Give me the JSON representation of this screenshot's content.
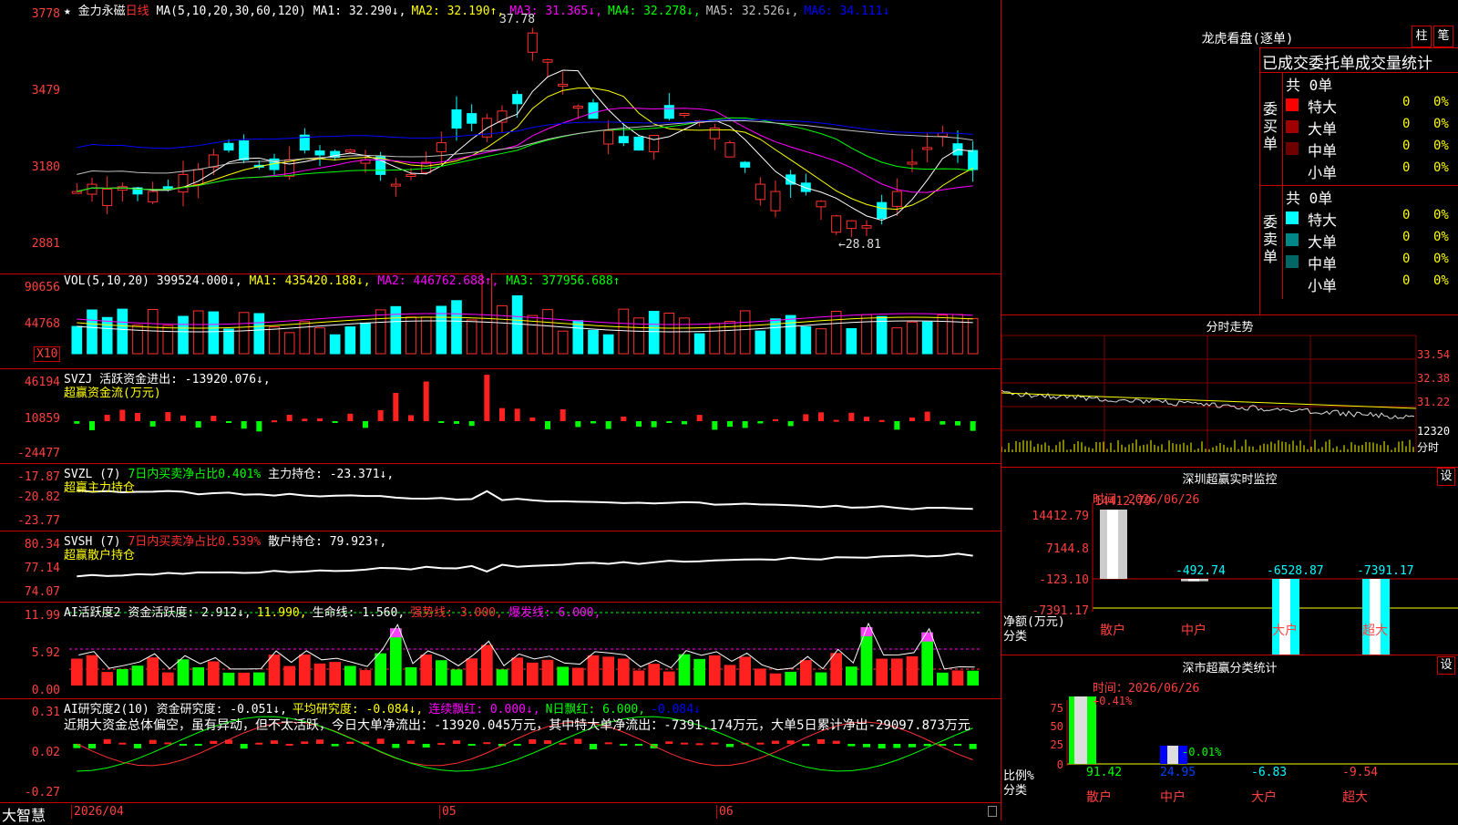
{
  "stock": {
    "name": "金力永磁",
    "period": "日线",
    "star": "★"
  },
  "main": {
    "ma_header": "MA(5,10,20,30,60,120)",
    "ma": [
      {
        "label": "MA1: 32.290↓,",
        "color": "#ffffff"
      },
      {
        "label": "MA2: 32.190↑,",
        "color": "#ffff00"
      },
      {
        "label": "MA3: 31.365↓,",
        "color": "#ff00ff"
      },
      {
        "label": "MA4: 32.278↓,",
        "color": "#00ff00"
      },
      {
        "label": "MA5: 32.526↓,",
        "color": "#c0c0c0"
      },
      {
        "label": "MA6: 34.111↓",
        "color": "#0000ff"
      }
    ],
    "high_label": "37.78",
    "low_label": "←28.81",
    "axis": [
      "3778",
      "3479",
      "3180",
      "2881"
    ],
    "price_range": [
      28.81,
      37.78
    ]
  },
  "vol": {
    "header": "VOL(5,10,20)",
    "value": "399524.000↓,",
    "ma1": "MA1: 435420.188↓,",
    "ma2": "MA2: 446762.688↑,",
    "ma3": "MA3: 377956.688↑",
    "axis": [
      "90656",
      "44768"
    ],
    "unit": "X10"
  },
  "svzj": {
    "header": "SVZJ",
    "desc": "活跃资金进出: -13920.076↓,",
    "sub": "超赢资金流(万元)",
    "axis": [
      "46194",
      "10859",
      "-24477"
    ]
  },
  "svzl": {
    "header": "SVZL (7)",
    "desc1": "7日内买卖净占比0.401%",
    "desc2": "主力持仓: -23.371↓,",
    "sub": "超赢主力持仓",
    "axis": [
      "-17.87",
      "-20.82",
      "-23.77"
    ]
  },
  "svsh": {
    "header": "SVSH (7)",
    "desc1": "7日内买卖净占比0.539%",
    "desc2": "散户持仓: 79.923↑,",
    "sub": "超赢散户持仓",
    "axis": [
      "80.34",
      "77.14",
      "74.07"
    ]
  },
  "ai1": {
    "header": "AI活跃度2",
    "parts": [
      {
        "text": "资金活跃度: 2.912↓,",
        "color": "#ffffff"
      },
      {
        "text": "11.990,",
        "color": "#ffff00"
      },
      {
        "text": "生命线: 1.560,",
        "color": "#ffffff"
      },
      {
        "text": "强势线: 3.000,",
        "color": "#ff3030"
      },
      {
        "text": "爆发线: 6.000,",
        "color": "#ff00ff"
      }
    ],
    "axis": [
      "11.99",
      "5.92",
      "0.00"
    ]
  },
  "ai2": {
    "header": "AI研究度2(10)",
    "parts": [
      {
        "text": "资金研究度: -0.051↓,",
        "color": "#ffffff"
      },
      {
        "text": "平均研究度: -0.084↓,",
        "color": "#ffff00"
      },
      {
        "text": "连续飘红: 0.000↓,",
        "color": "#ff00ff"
      },
      {
        "text": "N日飘红: 6.000,",
        "color": "#00ff00"
      },
      {
        "text": "-0.084↓",
        "color": "#0000ff"
      }
    ],
    "summary": "近期大资金总体偏空，虽有异动，但不太活跃，今日大单净流出：-13920.045万元，其中特大单净流出：-7391.174万元，大单5日累计净出-29097.873万元",
    "axis": [
      "0.31",
      "0.02",
      "-0.27"
    ]
  },
  "bottom": {
    "brand": "大智慧",
    "date": "2026/04",
    "m05": "05",
    "m06": "06"
  },
  "longhu": {
    "title": "龙虎看盘(逐单)",
    "btn1": "柱",
    "btn2": "笔",
    "tab_header": "已成交委托单成交量统计",
    "buy": {
      "total": "共 0单",
      "side": "委买单",
      "rows": [
        {
          "name": "特大",
          "val": "0",
          "pct": "0%",
          "color": "#ff0000"
        },
        {
          "name": "大单",
          "val": "0",
          "pct": "0%",
          "color": "#a00000"
        },
        {
          "name": "中单",
          "val": "0",
          "pct": "0%",
          "color": "#700000"
        },
        {
          "name": "小单",
          "val": "0",
          "pct": "0%",
          "color": "#000000"
        }
      ]
    },
    "sell": {
      "total": "共 0单",
      "side": "委卖单",
      "rows": [
        {
          "name": "特大",
          "val": "0",
          "pct": "0%",
          "color": "#00ffff"
        },
        {
          "name": "大单",
          "val": "0",
          "pct": "0%",
          "color": "#008888"
        },
        {
          "name": "中单",
          "val": "0",
          "pct": "0%",
          "color": "#006666"
        },
        {
          "name": "小单",
          "val": "0",
          "pct": "0%",
          "color": "#000000"
        }
      ]
    }
  },
  "fenshi": {
    "title": "分时走势",
    "axis": [
      "33.54",
      "32.38",
      "31.22"
    ],
    "vol": "12320",
    "unit": "分时"
  },
  "monitor": {
    "title": "深圳超赢实时监控",
    "btn": "设",
    "time": "时间：2026/06/26",
    "axis": [
      "14412.79",
      "7144.8",
      "-123.10",
      "-7391.17"
    ],
    "values": [
      {
        "label": "14412.79",
        "num": 14412.79
      },
      {
        "label": "-492.74",
        "num": -492.74
      },
      {
        "label": "-6528.87",
        "num": -6528.87
      },
      {
        "label": "-7391.17",
        "num": -7391.17
      }
    ],
    "ylabel": "净额(万元)",
    "xlabel": "分类",
    "cats": [
      "散户",
      "中户",
      "大户",
      "超大"
    ]
  },
  "stats": {
    "title": "深市超赢分类统计",
    "btn": "设",
    "time": "时间：2026/06/26",
    "top_labels": [
      "+0.41%",
      "-0.01%"
    ],
    "axis": [
      "75",
      "50",
      "25",
      "0"
    ],
    "ylabel": "比例%",
    "xlabel": "分类",
    "values": [
      "91.42",
      "24.95",
      "-6.83",
      "-9.54"
    ],
    "cats": [
      "散户",
      "中户",
      "大户",
      "超大"
    ]
  }
}
